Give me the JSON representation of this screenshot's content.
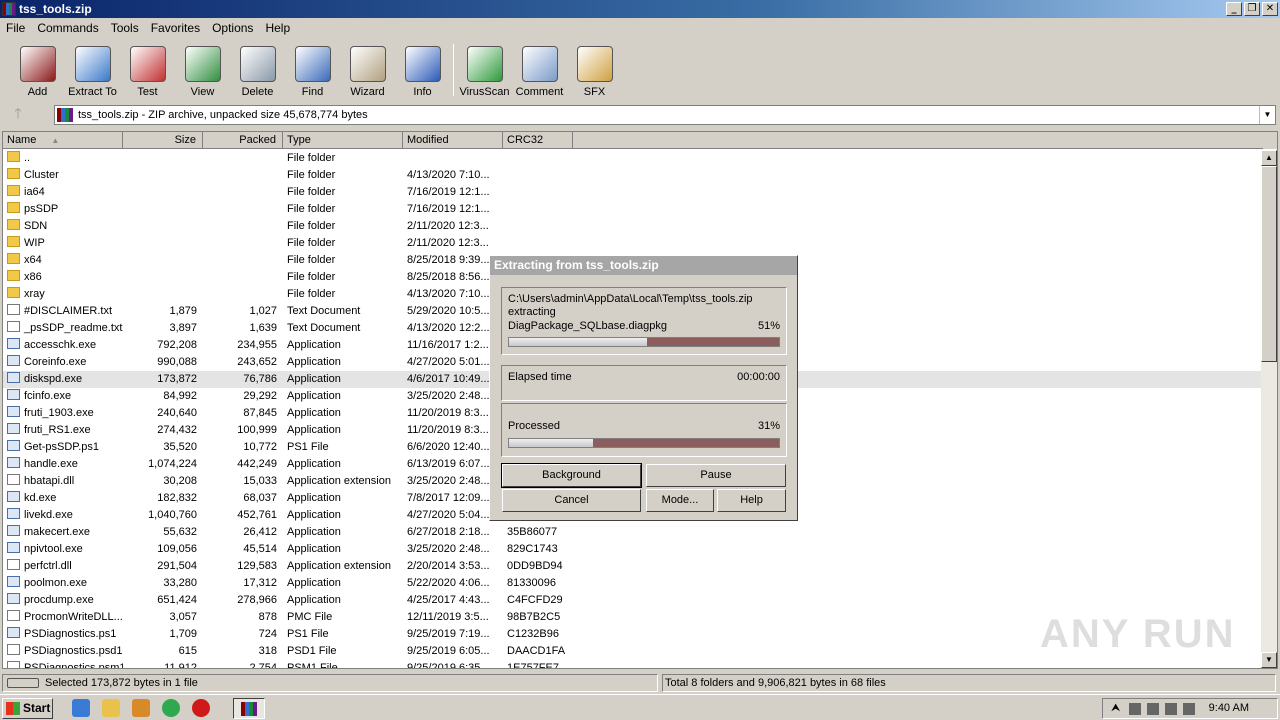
{
  "window": {
    "title": "tss_tools.zip",
    "buttons": [
      "_",
      "❐",
      "✕"
    ]
  },
  "menu": [
    "File",
    "Commands",
    "Tools",
    "Favorites",
    "Options",
    "Help"
  ],
  "toolbar": [
    {
      "label": "Add",
      "icon": "add-icon",
      "color": "#8b1a1a"
    },
    {
      "label": "Extract To",
      "icon": "extract-to-icon",
      "color": "#3a78c8"
    },
    {
      "label": "Test",
      "icon": "test-icon",
      "color": "#c03030"
    },
    {
      "label": "View",
      "icon": "view-icon",
      "color": "#2f8f3f"
    },
    {
      "label": "Delete",
      "icon": "delete-icon",
      "color": "#8a98a8"
    },
    {
      "label": "Find",
      "icon": "find-icon",
      "color": "#3a6ab8"
    },
    {
      "label": "Wizard",
      "icon": "wizard-icon",
      "color": "#b0a080"
    },
    {
      "label": "Info",
      "icon": "info-icon",
      "color": "#2a5ab8"
    },
    {
      "label": "VirusScan",
      "icon": "virusscan-icon",
      "color": "#2e9a3a"
    },
    {
      "label": "Comment",
      "icon": "comment-icon",
      "color": "#7a9ac8"
    },
    {
      "label": "SFX",
      "icon": "sfx-icon",
      "color": "#d0a040"
    }
  ],
  "address": {
    "up_arrow": "🡑",
    "text": "tss_tools.zip - ZIP archive, unpacked size 45,678,774 bytes",
    "dropdown": "▼"
  },
  "columns": [
    "Name",
    "Size",
    "Packed",
    "Type",
    "Modified",
    "CRC32"
  ],
  "sort_indicator": "▲",
  "files": [
    {
      "name": "..",
      "size": "",
      "packed": "",
      "type": "File folder",
      "modified": "",
      "crc": "",
      "kind": "folder"
    },
    {
      "name": "Cluster",
      "size": "",
      "packed": "",
      "type": "File folder",
      "modified": "4/13/2020 7:10...",
      "crc": "",
      "kind": "folder"
    },
    {
      "name": "ia64",
      "size": "",
      "packed": "",
      "type": "File folder",
      "modified": "7/16/2019 12:1...",
      "crc": "",
      "kind": "folder"
    },
    {
      "name": "psSDP",
      "size": "",
      "packed": "",
      "type": "File folder",
      "modified": "7/16/2019 12:1...",
      "crc": "",
      "kind": "folder"
    },
    {
      "name": "SDN",
      "size": "",
      "packed": "",
      "type": "File folder",
      "modified": "2/11/2020 12:3...",
      "crc": "",
      "kind": "folder"
    },
    {
      "name": "WIP",
      "size": "",
      "packed": "",
      "type": "File folder",
      "modified": "2/11/2020 12:3...",
      "crc": "",
      "kind": "folder"
    },
    {
      "name": "x64",
      "size": "",
      "packed": "",
      "type": "File folder",
      "modified": "8/25/2018 9:39...",
      "crc": "",
      "kind": "folder"
    },
    {
      "name": "x86",
      "size": "",
      "packed": "",
      "type": "File folder",
      "modified": "8/25/2018 8:56...",
      "crc": "",
      "kind": "folder"
    },
    {
      "name": "xray",
      "size": "",
      "packed": "",
      "type": "File folder",
      "modified": "4/13/2020 7:10...",
      "crc": "",
      "kind": "folder"
    },
    {
      "name": "#DISCLAIMER.txt",
      "size": "1,879",
      "packed": "1,027",
      "type": "Text Document",
      "modified": "5/29/2020 10:5...",
      "crc": "",
      "kind": "file"
    },
    {
      "name": "_psSDP_readme.txt",
      "size": "3,897",
      "packed": "1,639",
      "type": "Text Document",
      "modified": "4/13/2020 12:2...",
      "crc": "",
      "kind": "file"
    },
    {
      "name": "accesschk.exe",
      "size": "792,208",
      "packed": "234,955",
      "type": "Application",
      "modified": "11/16/2017 1:2...",
      "crc": "",
      "kind": "exe"
    },
    {
      "name": "Coreinfo.exe",
      "size": "990,088",
      "packed": "243,652",
      "type": "Application",
      "modified": "4/27/2020 5:01...",
      "crc": "",
      "kind": "exe"
    },
    {
      "name": "diskspd.exe",
      "size": "173,872",
      "packed": "76,786",
      "type": "Application",
      "modified": "4/6/2017 10:49...",
      "crc": "",
      "kind": "exe",
      "selected": true
    },
    {
      "name": "fcinfo.exe",
      "size": "84,992",
      "packed": "29,292",
      "type": "Application",
      "modified": "3/25/2020 2:48...",
      "crc": "",
      "kind": "exe"
    },
    {
      "name": "fruti_1903.exe",
      "size": "240,640",
      "packed": "87,845",
      "type": "Application",
      "modified": "11/20/2019 8:3...",
      "crc": "",
      "kind": "exe"
    },
    {
      "name": "fruti_RS1.exe",
      "size": "274,432",
      "packed": "100,999",
      "type": "Application",
      "modified": "11/20/2019 8:3...",
      "crc": "",
      "kind": "exe"
    },
    {
      "name": "Get-psSDP.ps1",
      "size": "35,520",
      "packed": "10,772",
      "type": "PS1 File",
      "modified": "6/6/2020 12:40...",
      "crc": "",
      "kind": "exe"
    },
    {
      "name": "handle.exe",
      "size": "1,074,224",
      "packed": "442,249",
      "type": "Application",
      "modified": "6/13/2019 6:07...",
      "crc": "",
      "kind": "exe"
    },
    {
      "name": "hbatapi.dll",
      "size": "30,208",
      "packed": "15,033",
      "type": "Application extension",
      "modified": "3/25/2020 2:48...",
      "crc": "",
      "kind": "file"
    },
    {
      "name": "kd.exe",
      "size": "182,832",
      "packed": "68,037",
      "type": "Application",
      "modified": "7/8/2017 12:09...",
      "crc": "",
      "kind": "exe"
    },
    {
      "name": "livekd.exe",
      "size": "1,040,760",
      "packed": "452,761",
      "type": "Application",
      "modified": "4/27/2020 5:04...",
      "crc": "",
      "kind": "exe"
    },
    {
      "name": "makecert.exe",
      "size": "55,632",
      "packed": "26,412",
      "type": "Application",
      "modified": "6/27/2018 2:18...",
      "crc": "35B86077",
      "kind": "exe"
    },
    {
      "name": "npivtool.exe",
      "size": "109,056",
      "packed": "45,514",
      "type": "Application",
      "modified": "3/25/2020 2:48...",
      "crc": "829C1743",
      "kind": "exe"
    },
    {
      "name": "perfctrl.dll",
      "size": "291,504",
      "packed": "129,583",
      "type": "Application extension",
      "modified": "2/20/2014 3:53...",
      "crc": "0DD9BD94",
      "kind": "file"
    },
    {
      "name": "poolmon.exe",
      "size": "33,280",
      "packed": "17,312",
      "type": "Application",
      "modified": "5/22/2020 4:06...",
      "crc": "81330096",
      "kind": "exe"
    },
    {
      "name": "procdump.exe",
      "size": "651,424",
      "packed": "278,966",
      "type": "Application",
      "modified": "4/25/2017 4:43...",
      "crc": "C4FCFD29",
      "kind": "exe"
    },
    {
      "name": "ProcmonWriteDLL...",
      "size": "3,057",
      "packed": "878",
      "type": "PMC File",
      "modified": "12/11/2019 3:5...",
      "crc": "98B7B2C5",
      "kind": "file"
    },
    {
      "name": "PSDiagnostics.ps1",
      "size": "1,709",
      "packed": "724",
      "type": "PS1 File",
      "modified": "9/25/2019 7:19...",
      "crc": "C1232B96",
      "kind": "exe"
    },
    {
      "name": "PSDiagnostics.psd1",
      "size": "615",
      "packed": "318",
      "type": "PSD1 File",
      "modified": "9/25/2019 6:05...",
      "crc": "DAACD1FA",
      "kind": "file"
    },
    {
      "name": "PSDiagnostics.psm1",
      "size": "11,912",
      "packed": "2,754",
      "type": "PSM1 File",
      "modified": "9/25/2019 6:35...",
      "crc": "1E757FE7",
      "kind": "file"
    }
  ],
  "dialog": {
    "title": "Extracting from tss_tools.zip",
    "path": "C:\\Users\\admin\\AppData\\Local\\Temp\\tss_tools.zip",
    "action": "extracting",
    "current_file": "DiagPackage_SQLbase.diagpkg",
    "file_percent": "51%",
    "file_progress": 0.51,
    "elapsed_label": "Elapsed time",
    "elapsed_value": "00:00:00",
    "processed_label": "Processed",
    "processed_percent": "31%",
    "processed_progress": 0.31,
    "buttons": {
      "background": "Background",
      "pause": "Pause",
      "cancel": "Cancel",
      "mode": "Mode...",
      "help": "Help"
    }
  },
  "status": {
    "left": "Selected 173,872 bytes in 1 file",
    "right": "Total 8 folders and 9,906,821 bytes in 68 files"
  },
  "taskbar": {
    "start": "Start",
    "clock": "9:40 AM",
    "tray_arrow": "⮝"
  },
  "watermark": "ANY RUN"
}
